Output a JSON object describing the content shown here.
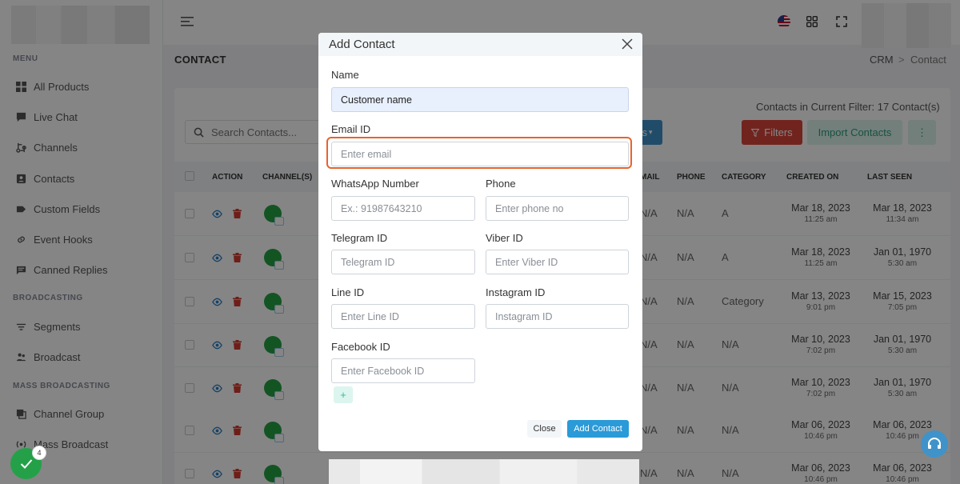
{
  "sidebar": {
    "sections": [
      "MENU",
      "BROADCASTING",
      "MASS BROADCASTING"
    ],
    "menu_items": [
      {
        "label": "All Products",
        "icon": "grid-icon"
      },
      {
        "label": "Live Chat",
        "icon": "chat-icon"
      },
      {
        "label": "Channels",
        "icon": "channels-icon"
      },
      {
        "label": "Contacts",
        "icon": "contacts-icon"
      },
      {
        "label": "Custom Fields",
        "icon": "tag-icon"
      },
      {
        "label": "Event Hooks",
        "icon": "link-icon"
      },
      {
        "label": "Canned Replies",
        "icon": "message-icon"
      }
    ],
    "broadcasting_items": [
      {
        "label": "Segments",
        "icon": "segments-icon"
      },
      {
        "label": "Broadcast",
        "icon": "broadcast-icon"
      }
    ],
    "mass_items": [
      {
        "label": "Channel Group",
        "icon": "channel-group-icon"
      },
      {
        "label": "Mass Broadcast",
        "icon": "mass-broadcast-icon"
      }
    ]
  },
  "header": {
    "page_title": "CONTACT",
    "breadcrumb": [
      "CRM",
      "Contact"
    ],
    "breadcrumb_sep": ">"
  },
  "toolbar": {
    "search_placeholder": "Search Contacts...",
    "contacts_count": "Contacts in Current Filter: 17 Contact(s)",
    "hidden_btn_fragment": "s",
    "filters_label": "Filters",
    "import_label": "Import Contacts",
    "more_label": "⋮"
  },
  "table": {
    "columns": [
      "ACTION",
      "CHANNEL(S)",
      "MAIL",
      "PHONE",
      "CATEGORY",
      "CREATED ON",
      "LAST SEEN"
    ],
    "rows": [
      {
        "email": "N/A",
        "phone": "N/A",
        "category": "A",
        "created_date": "Mar 18, 2023",
        "created_time": "11:25 am",
        "seen_date": "Mar 18, 2023",
        "seen_time": "11:34 am"
      },
      {
        "email": "N/A",
        "phone": "N/A",
        "category": "A",
        "created_date": "Mar 18, 2023",
        "created_time": "11:25 am",
        "seen_date": "Jan 01, 1970",
        "seen_time": "5:30 am"
      },
      {
        "email": "N/A",
        "phone": "N/A",
        "category": "Category",
        "created_date": "Mar 13, 2023",
        "created_time": "9:01 pm",
        "seen_date": "Mar 15, 2023",
        "seen_time": "7:05 pm"
      },
      {
        "email": "N/A",
        "phone": "N/A",
        "category": "N/A",
        "created_date": "Mar 10, 2023",
        "created_time": "7:02 pm",
        "seen_date": "Jan 01, 1970",
        "seen_time": "5:30 am"
      },
      {
        "email": "N/A",
        "phone": "N/A",
        "category": "N/A",
        "created_date": "Mar 10, 2023",
        "created_time": "7:02 pm",
        "seen_date": "Jan 01, 1970",
        "seen_time": "5:30 am"
      },
      {
        "email": "N/A",
        "phone": "N/A",
        "category": "N/A",
        "created_date": "Mar 06, 2023",
        "created_time": "10:46 pm",
        "seen_date": "Mar 06, 2023",
        "seen_time": "10:46 pm"
      },
      {
        "email": "N/A",
        "phone": "N/A",
        "category": "N/A",
        "created_date": "Mar 06, 2023",
        "created_time": "10:46 pm",
        "seen_date": "Mar 06, 2023",
        "seen_time": "10:46 pm"
      }
    ]
  },
  "modal": {
    "title": "Add Contact",
    "fields": {
      "name": {
        "label": "Name",
        "value": "Customer name"
      },
      "email": {
        "label": "Email ID",
        "placeholder": "Enter email"
      },
      "whatsapp": {
        "label": "WhatsApp Number",
        "placeholder": "Ex.: 91987643210"
      },
      "phone": {
        "label": "Phone",
        "placeholder": "Enter phone no"
      },
      "telegram": {
        "label": "Telegram ID",
        "placeholder": "Telegram ID"
      },
      "viber": {
        "label": "Viber ID",
        "placeholder": "Enter Viber ID"
      },
      "line": {
        "label": "Line ID",
        "placeholder": "Enter Line ID"
      },
      "instagram": {
        "label": "Instagram ID",
        "placeholder": "Instagram ID"
      },
      "facebook": {
        "label": "Facebook ID",
        "placeholder": "Enter Facebook ID"
      }
    },
    "add_field_label": "+",
    "close_label": "Close",
    "submit_label": "Add Contact"
  },
  "notifications": {
    "badge_count": "4"
  },
  "colors": {
    "filters": "#d9463a",
    "import": "#dcf3ec",
    "primary": "#3f93c9",
    "focus": "#e8632a",
    "success": "#24a148"
  }
}
